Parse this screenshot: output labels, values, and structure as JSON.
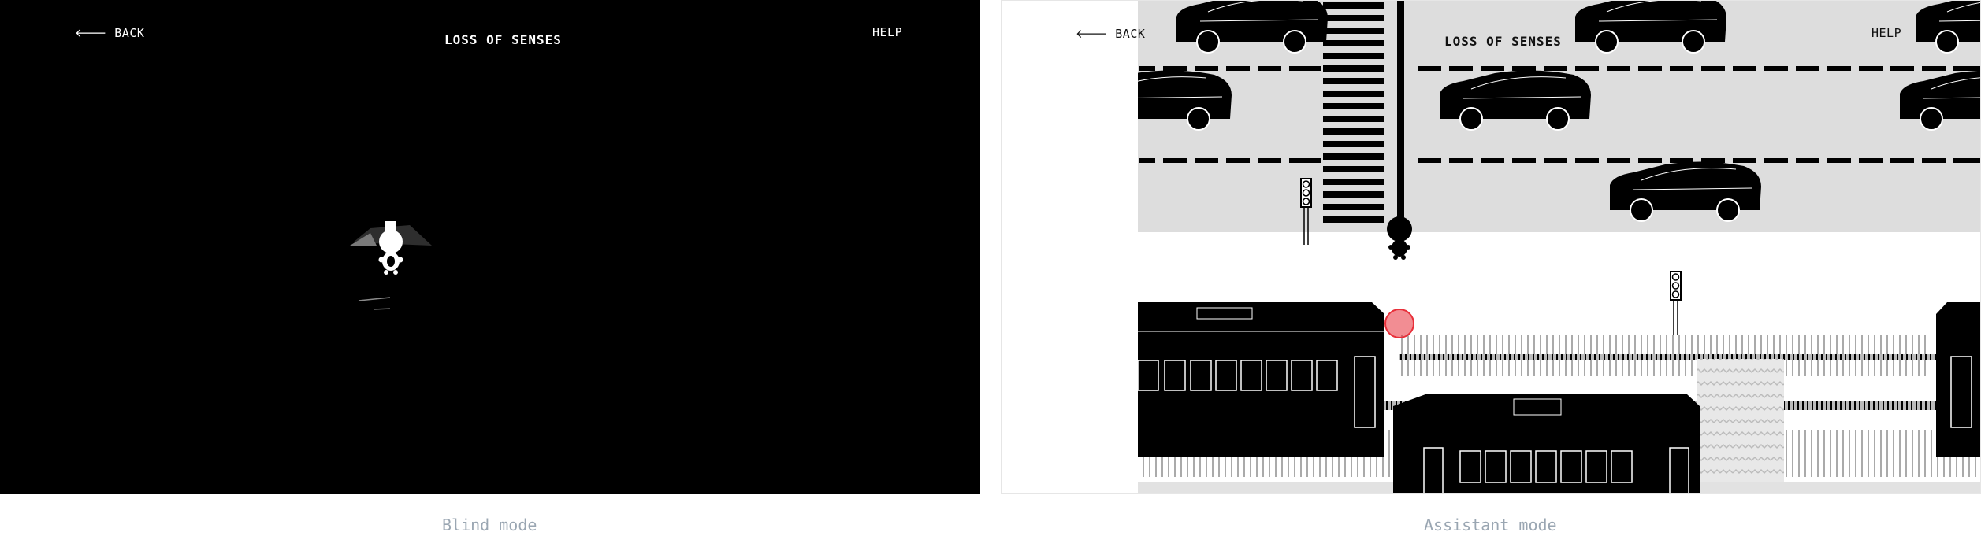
{
  "blind_panel": {
    "back_label": "BACK",
    "title": "LOSS OF SENSES",
    "help_label": "HELP",
    "caption": "Blind mode"
  },
  "assistant_panel": {
    "back_label": "BACK",
    "title": "LOSS OF SENSES",
    "help_label": "HELP",
    "caption": "Assistant mode"
  },
  "icons": {
    "back": "arrow-left-icon",
    "player": "stick-figure-icon",
    "target": "red-circle-marker-icon"
  },
  "colors": {
    "blind_bg": "#000000",
    "road": "#dddddd",
    "marker": "#e8303a"
  }
}
